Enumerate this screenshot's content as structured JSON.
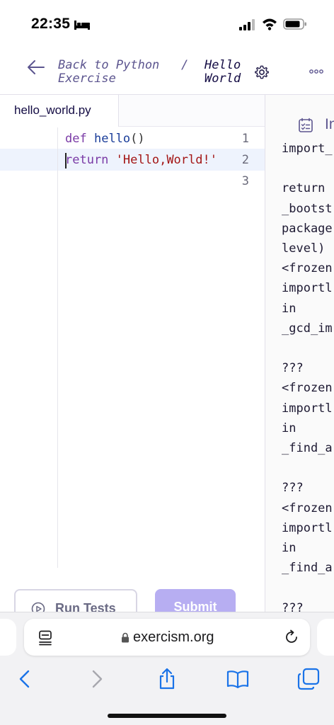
{
  "status_bar": {
    "time": "22:35"
  },
  "header": {
    "back_line1": "Back to Python",
    "back_line2": "Exercise",
    "separator": "/",
    "title_line1": "Hello",
    "title_line2": "World"
  },
  "editor": {
    "file_tab": "hello_world.py",
    "line_numbers": [
      "1",
      "2",
      "3"
    ],
    "line1": {
      "kw": "def",
      "fn": "hello",
      "punc": "()"
    },
    "line2": {
      "kw": "return",
      "str": "'Hello,World!'"
    }
  },
  "actions": {
    "run_tests": "Run Tests",
    "submit": "Submit"
  },
  "panel": {
    "tab_label": "Instructions",
    "traceback_lines": [
      "import_",
      "",
      "return",
      "_bootst",
      "package",
      "level)",
      "<frozen",
      "importl",
      "in",
      "_gcd_im",
      "",
      "???",
      "<frozen",
      "importl",
      "in",
      "_find_a",
      "",
      "???",
      "<frozen",
      "importl",
      "in",
      "_find_a",
      "",
      "???"
    ]
  },
  "browser": {
    "url": "exercism.org"
  },
  "colors": {
    "brand_purple": "#5c558f",
    "submit_disabled": "#b7aef2",
    "keyword": "#7a3aa6",
    "function": "#1a3d99",
    "string": "#a31515",
    "safari_blue": "#1a73e8"
  }
}
